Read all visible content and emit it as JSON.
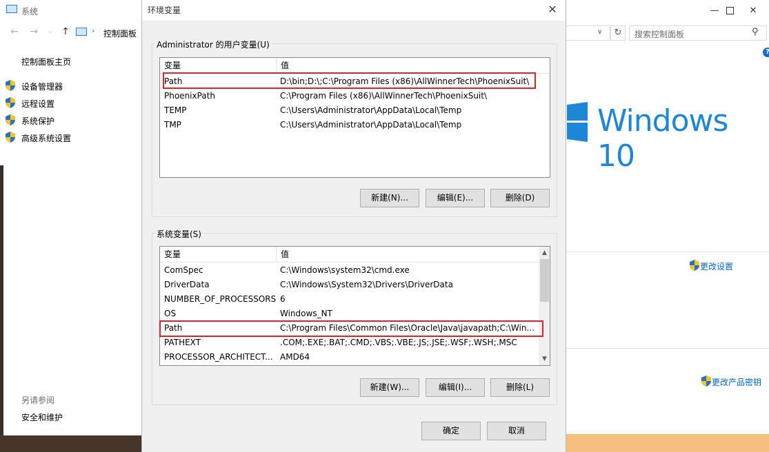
{
  "bg_window": {
    "title": "系统",
    "address_crumb": "控制面板",
    "address_sep": "›",
    "search_placeholder": "搜索控制面板",
    "home_link": "控制面板主页",
    "side_links": [
      "设备管理器",
      "远程设置",
      "系统保护",
      "高级系统设置"
    ],
    "see_also": "另请参阅",
    "safety_link": "安全和维护",
    "brand_text": "Windows 10",
    "change_settings": "更改设置",
    "change_product_key": "更改产品密钥",
    "help_glyph": "?"
  },
  "dialog": {
    "title": "环境变量",
    "user_group_label": "Administrator 的用户变量(U)",
    "system_group_label": "系统变量(S)",
    "col_name": "变量",
    "col_value": "值",
    "user_vars": [
      {
        "name": "Path",
        "value": "D:\\bin;D:\\;C:\\Program Files (x86)\\AllWinnerTech\\PhoenixSuit\\"
      },
      {
        "name": "PhoenixPath",
        "value": "C:\\Program Files (x86)\\AllWinnerTech\\PhoenixSuit\\"
      },
      {
        "name": "TEMP",
        "value": "C:\\Users\\Administrator\\AppData\\Local\\Temp"
      },
      {
        "name": "TMP",
        "value": "C:\\Users\\Administrator\\AppData\\Local\\Temp"
      }
    ],
    "system_vars": [
      {
        "name": "ComSpec",
        "value": "C:\\Windows\\system32\\cmd.exe"
      },
      {
        "name": "DriverData",
        "value": "C:\\Windows\\System32\\Drivers\\DriverData"
      },
      {
        "name": "NUMBER_OF_PROCESSORS",
        "value": "6"
      },
      {
        "name": "OS",
        "value": "Windows_NT"
      },
      {
        "name": "Path",
        "value": "C:\\Program Files\\Common Files\\Oracle\\Java\\javapath;C:\\Win..."
      },
      {
        "name": "PATHEXT",
        "value": ".COM;.EXE;.BAT;.CMD;.VBS;.VBE;.JS;.JSE;.WSF;.WSH;.MSC"
      },
      {
        "name": "PROCESSOR_ARCHITECT...",
        "value": "AMD64"
      }
    ],
    "user_buttons": {
      "new": "新建(N)...",
      "edit": "编辑(E)...",
      "delete": "删除(D)"
    },
    "system_buttons": {
      "new": "新建(W)...",
      "edit": "编辑(I)...",
      "delete": "删除(L)"
    },
    "ok": "确定",
    "cancel": "取消",
    "close_glyph": "✕"
  },
  "colors": {
    "highlight_border": "#e0202a",
    "link": "#0066cc",
    "win10_blue": "#1e86d6"
  }
}
